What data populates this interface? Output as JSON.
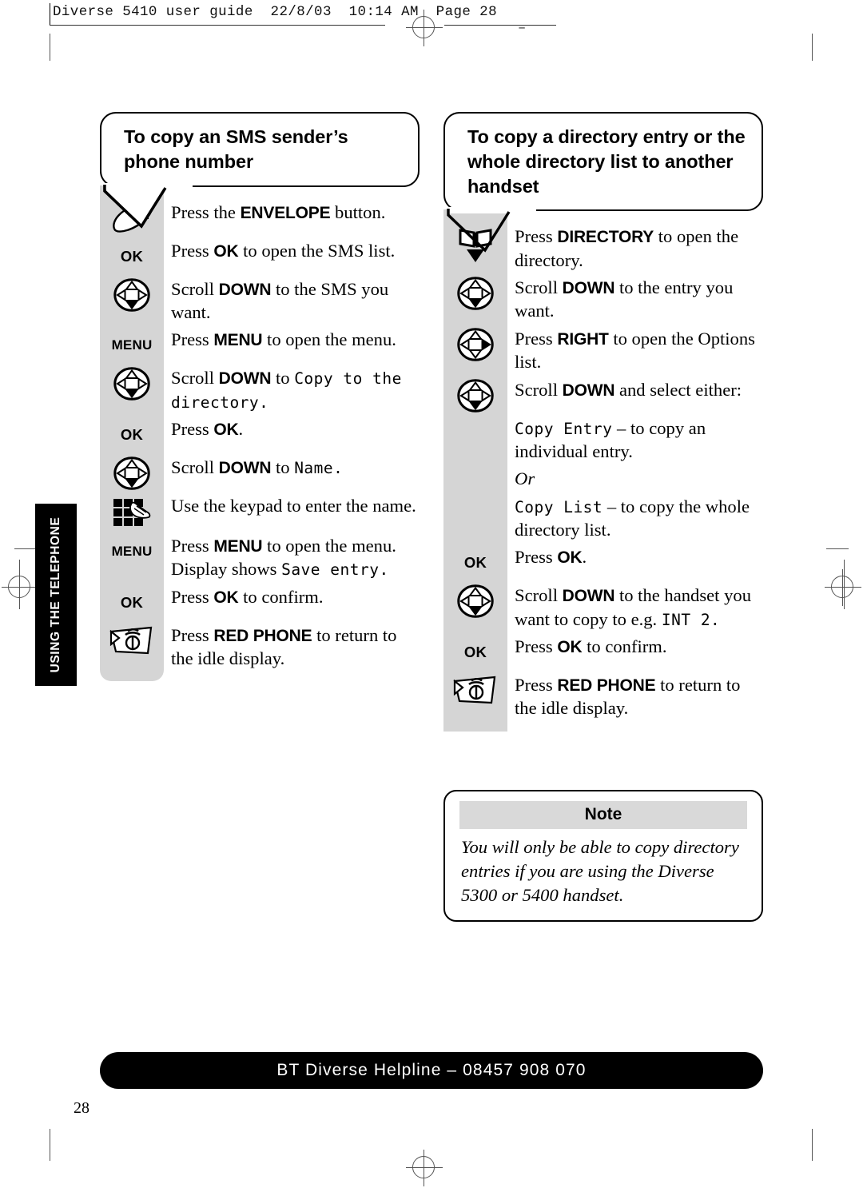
{
  "print_header": "Diverse 5410 user guide  22/8/03  10:14 AM  Page 28",
  "side_tab": "USING THE TELEPHONE",
  "page_number": "28",
  "footer": "BT Diverse Helpline – 08457 908 070",
  "colors": {
    "gutter_grey": "#d5d5d5",
    "note_header_grey": "#d9d9d9",
    "bar_black": "#000000",
    "page_white": "#ffffff"
  },
  "left_column": {
    "heading": "To copy an SMS sender’s phone number",
    "steps": [
      {
        "icon": "envelope-button-icon",
        "icon_label": "",
        "parts": [
          {
            "t": "Press the ",
            "s": "plain"
          },
          {
            "t": "ENVELOPE",
            "s": "key"
          },
          {
            "t": " button.",
            "s": "plain"
          }
        ]
      },
      {
        "icon": "ok-key-icon",
        "icon_label": "OK",
        "parts": [
          {
            "t": "Press ",
            "s": "plain"
          },
          {
            "t": "OK",
            "s": "key"
          },
          {
            "t": " to open the SMS list.",
            "s": "plain"
          }
        ]
      },
      {
        "icon": "navpad-down-icon",
        "icon_label": "",
        "parts": [
          {
            "t": "Scroll ",
            "s": "plain"
          },
          {
            "t": "DOWN",
            "s": "key"
          },
          {
            "t": " to the SMS you want.",
            "s": "plain"
          }
        ]
      },
      {
        "icon": "menu-key-icon",
        "icon_label": "MENU",
        "parts": [
          {
            "t": "Press ",
            "s": "plain"
          },
          {
            "t": "MENU",
            "s": "key"
          },
          {
            "t": " to open the menu.",
            "s": "plain"
          }
        ]
      },
      {
        "icon": "navpad-down-icon",
        "icon_label": "",
        "parts": [
          {
            "t": "Scroll ",
            "s": "plain"
          },
          {
            "t": "DOWN",
            "s": "key"
          },
          {
            "t": " to ",
            "s": "plain"
          },
          {
            "t": "Copy to the directory.",
            "s": "lcd"
          }
        ]
      },
      {
        "icon": "ok-key-icon",
        "icon_label": "OK",
        "parts": [
          {
            "t": "Press ",
            "s": "plain"
          },
          {
            "t": "OK",
            "s": "key"
          },
          {
            "t": ".",
            "s": "plain"
          }
        ]
      },
      {
        "icon": "navpad-down-icon",
        "icon_label": "",
        "parts": [
          {
            "t": "Scroll ",
            "s": "plain"
          },
          {
            "t": "DOWN",
            "s": "key"
          },
          {
            "t": " to ",
            "s": "plain"
          },
          {
            "t": "Name.",
            "s": "lcd"
          }
        ]
      },
      {
        "icon": "keypad-icon",
        "icon_label": "",
        "parts": [
          {
            "t": "Use the keypad to enter the name.",
            "s": "plain"
          }
        ]
      },
      {
        "icon": "menu-key-icon",
        "icon_label": "MENU",
        "parts": [
          {
            "t": "Press ",
            "s": "plain"
          },
          {
            "t": "MENU",
            "s": "key"
          },
          {
            "t": " to open the menu. Display shows ",
            "s": "plain"
          },
          {
            "t": "Save entry.",
            "s": "lcd"
          }
        ]
      },
      {
        "icon": "ok-key-icon",
        "icon_label": "OK",
        "parts": [
          {
            "t": "Press ",
            "s": "plain"
          },
          {
            "t": "OK",
            "s": "key"
          },
          {
            "t": " to confirm.",
            "s": "plain"
          }
        ]
      },
      {
        "icon": "red-phone-icon",
        "icon_label": "",
        "parts": [
          {
            "t": "Press ",
            "s": "plain"
          },
          {
            "t": "RED PHONE",
            "s": "key"
          },
          {
            "t": " to return to the idle display.",
            "s": "plain"
          }
        ]
      }
    ]
  },
  "right_column": {
    "heading": "To copy a directory entry or the whole directory list to another handset",
    "steps": [
      {
        "icon": "directory-book-icon",
        "icon_label": "",
        "parts": [
          {
            "t": "Press ",
            "s": "plain"
          },
          {
            "t": "DIRECTORY",
            "s": "key"
          },
          {
            "t": " to open the directory.",
            "s": "plain"
          }
        ]
      },
      {
        "icon": "navpad-down-icon",
        "icon_label": "",
        "parts": [
          {
            "t": "Scroll ",
            "s": "plain"
          },
          {
            "t": "DOWN",
            "s": "key"
          },
          {
            "t": " to the entry you want.",
            "s": "plain"
          }
        ]
      },
      {
        "icon": "navpad-right-icon",
        "icon_label": "",
        "parts": [
          {
            "t": "Press ",
            "s": "plain"
          },
          {
            "t": "RIGHT",
            "s": "key"
          },
          {
            "t": " to open the Options list.",
            "s": "plain"
          }
        ]
      },
      {
        "icon": "navpad-down-icon",
        "icon_label": "",
        "parts": [
          {
            "t": "Scroll ",
            "s": "plain"
          },
          {
            "t": "DOWN",
            "s": "key"
          },
          {
            "t": " and select either:",
            "s": "plain"
          }
        ]
      },
      {
        "icon": "none",
        "icon_label": "",
        "parts": [
          {
            "t": "Copy Entry",
            "s": "lcd"
          },
          {
            "t": " – to copy an individual entry.",
            "s": "plain"
          }
        ]
      },
      {
        "icon": "none",
        "icon_label": "",
        "parts": [
          {
            "t": "Or",
            "s": "italic"
          }
        ]
      },
      {
        "icon": "none",
        "icon_label": "",
        "parts": [
          {
            "t": "Copy List",
            "s": "lcd"
          },
          {
            "t": " – to copy the whole directory list.",
            "s": "plain"
          }
        ]
      },
      {
        "icon": "ok-key-icon",
        "icon_label": "OK",
        "parts": [
          {
            "t": "Press ",
            "s": "plain"
          },
          {
            "t": "OK",
            "s": "key"
          },
          {
            "t": ".",
            "s": "plain"
          }
        ]
      },
      {
        "icon": "navpad-down-icon",
        "icon_label": "",
        "parts": [
          {
            "t": "Scroll ",
            "s": "plain"
          },
          {
            "t": "DOWN",
            "s": "key"
          },
          {
            "t": " to the handset you want to copy to e.g. ",
            "s": "plain"
          },
          {
            "t": "INT 2.",
            "s": "lcd"
          }
        ]
      },
      {
        "icon": "ok-key-icon",
        "icon_label": "OK",
        "parts": [
          {
            "t": "Press ",
            "s": "plain"
          },
          {
            "t": "OK",
            "s": "key"
          },
          {
            "t": " to confirm.",
            "s": "plain"
          }
        ]
      },
      {
        "icon": "red-phone-icon",
        "icon_label": "",
        "parts": [
          {
            "t": "Press ",
            "s": "plain"
          },
          {
            "t": "RED PHONE",
            "s": "key"
          },
          {
            "t": " to return to the idle display.",
            "s": "plain"
          }
        ]
      }
    ]
  },
  "note": {
    "title": "Note",
    "body": "You will only be able to copy directory entries if you are using the Diverse 5300 or 5400 handset."
  }
}
